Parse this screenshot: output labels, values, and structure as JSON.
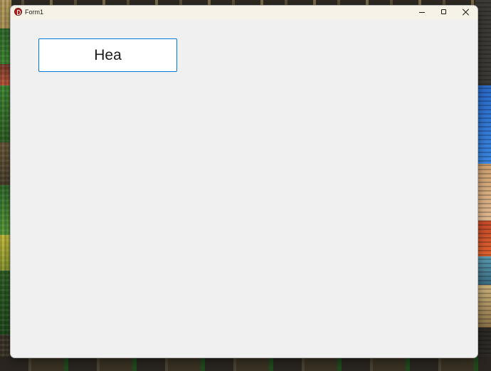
{
  "window": {
    "title": "Form1",
    "accent_color": "#0078d7",
    "icon": "delphi-app-icon"
  },
  "caption_buttons": {
    "minimize": "minimize-icon",
    "maximize": "maximize-icon",
    "close": "close-icon"
  },
  "form": {
    "textbox_value": "Hea"
  }
}
